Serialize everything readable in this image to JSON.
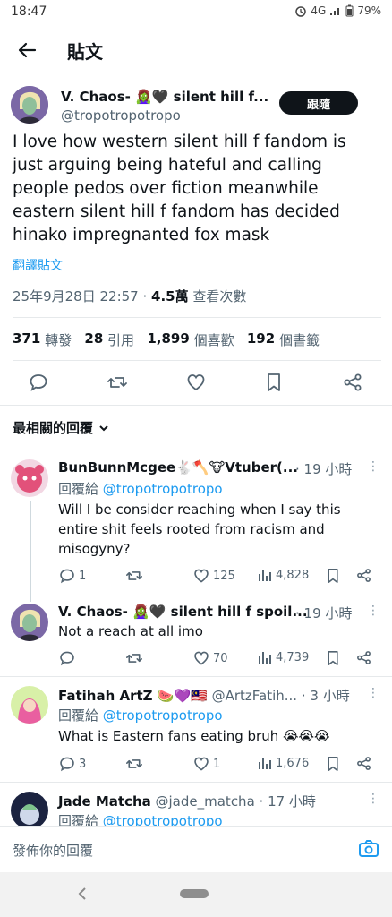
{
  "status": {
    "time": "18:47",
    "network": "4G",
    "battery": "79%"
  },
  "header": {
    "title": "貼文"
  },
  "post": {
    "author": "V. Chaos- 🧟‍♀️🖤 silent hill f...",
    "handle": "@tropotropotropo",
    "follow_label": "跟隨",
    "text": "I love how western silent hill f fandom is just arguing being hateful and calling people pedos over fiction meanwhile eastern silent hill f fandom has decided hinako impregnanted fox mask",
    "translate_label": "翻譯貼文",
    "timestamp": "25年9月28日 22:57 · ",
    "views_value": "4.5萬",
    "views_label": " 查看次數",
    "stats": {
      "reposts": "371",
      "reposts_label": " 轉發   ",
      "quotes": "28",
      "quotes_label": " 引用   ",
      "likes": "1,899",
      "likes_label": " 個喜歡   ",
      "bookmarks": "192",
      "bookmarks_label": " 個書籤"
    }
  },
  "sort_label": "最相關的回覆",
  "replies": [
    {
      "name": "BunBunnMcgee🐇🪓🐮Vtuber(...",
      "time": " · 19 小時",
      "reply_to_prefix": "回覆給 ",
      "reply_to": "@tropotropotropo",
      "text": "Will I be consider reaching when I say this entire shit feels rooted from racism and misogyny?",
      "replies": "1",
      "reposts": "",
      "likes": "125",
      "views": "4,828"
    },
    {
      "name": "V. Chaos- 🧟‍♀️🖤 silent hill f spoil...",
      "time": " · 19 小時",
      "text": "Not a reach at all imo",
      "replies": "",
      "reposts": "",
      "likes": "70",
      "views": "4,739"
    },
    {
      "name": "Fatihah ArtZ 🍉💜🇲🇾",
      "handle": " @ArtzFatih...",
      "time": " · 3 小時",
      "reply_to_prefix": "回覆給 ",
      "reply_to": "@tropotropotropo",
      "text": "What is Eastern fans eating bruh 😭😭😭",
      "replies": "3",
      "reposts": "",
      "likes": "1",
      "views": "1,676"
    },
    {
      "name": "Jade Matcha",
      "handle": " @jade_matcha",
      "time": " · 17 小時",
      "reply_to_prefix": "回覆給 ",
      "reply_to": "@tropotropotropo"
    }
  ],
  "compose": {
    "placeholder": "發佈你的回覆"
  },
  "colors": {
    "link": "#1d9bf0",
    "text": "#0f1419",
    "muted": "#536471"
  }
}
